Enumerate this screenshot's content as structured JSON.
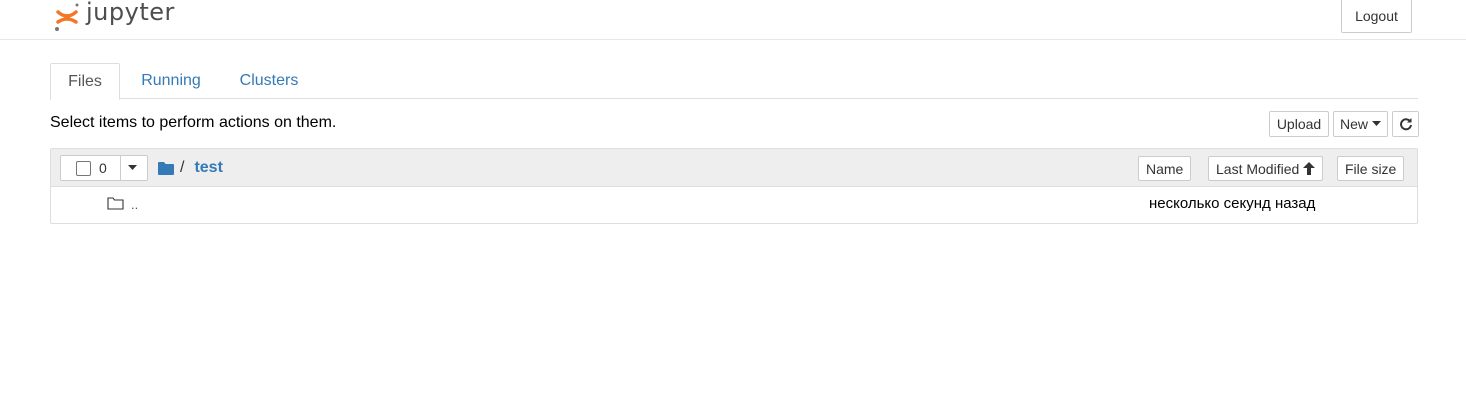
{
  "header": {
    "logo_text": "jupyter",
    "logout_label": "Logout"
  },
  "tabs": [
    {
      "label": "Files",
      "active": true
    },
    {
      "label": "Running",
      "active": false
    },
    {
      "label": "Clusters",
      "active": false
    }
  ],
  "toolbar": {
    "hint": "Select items to perform actions on them.",
    "upload_label": "Upload",
    "new_label": "New",
    "refresh_icon": "refresh-icon"
  },
  "list_header": {
    "selected_count": "0",
    "breadcrumb_sep": "/",
    "current_dir": "test",
    "sort_name": "Name",
    "sort_modified": "Last Modified",
    "sort_size": "File size"
  },
  "rows": [
    {
      "name": "..",
      "icon": "folder-icon",
      "modified": "несколько секунд назад"
    }
  ],
  "colors": {
    "link": "#337ab7",
    "logo_orange": "#f37726",
    "panel_head_bg": "#eeeeee"
  }
}
